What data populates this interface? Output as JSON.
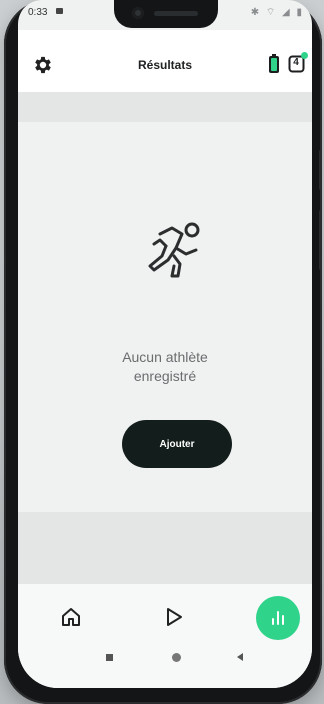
{
  "status_bar": {
    "time": "0:33",
    "icons_text": "✱ ⌔ ◢ ▮"
  },
  "app_bar": {
    "title": "Résultats",
    "settings_icon": "gear-icon",
    "battery_icon": "battery-icon",
    "count_badge": "4",
    "count_dot_color": "#2fd38a"
  },
  "empty_state": {
    "icon": "runner-icon",
    "message_line1": "Aucun athlète",
    "message_line2": "enregistré",
    "add_button_label": "Ajouter"
  },
  "bottom_nav": {
    "items": [
      {
        "icon": "home-icon",
        "active": false
      },
      {
        "icon": "play-icon",
        "active": false
      },
      {
        "icon": "bar-chart-icon",
        "active": true
      }
    ],
    "active_color": "#2fd38a"
  },
  "system_nav": {
    "items": [
      "recent-apps-icon",
      "home-circle-icon",
      "back-icon"
    ]
  },
  "colors": {
    "accent": "#2fd38a",
    "button_dark": "#131d1b",
    "background": "#f0f1f1"
  }
}
